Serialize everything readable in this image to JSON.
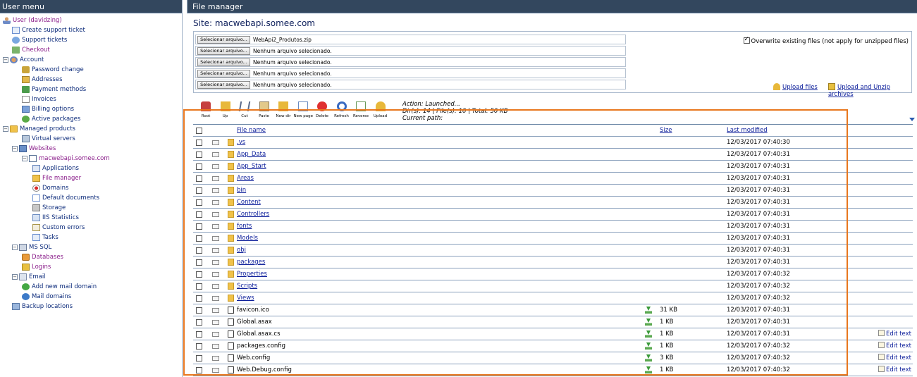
{
  "sidebar": {
    "header": "User menu",
    "items": [
      {
        "label": "User (davidzing)",
        "icon": "user-icon",
        "indent": 0,
        "toggle": "",
        "style": "sel"
      },
      {
        "label": "Create support ticket",
        "icon": "ticket-icon",
        "indent": 1,
        "toggle": "",
        "style": ""
      },
      {
        "label": "Support tickets",
        "icon": "help-icon",
        "indent": 1,
        "toggle": "",
        "style": ""
      },
      {
        "label": "Checkout",
        "icon": "cart-icon",
        "indent": 1,
        "toggle": "",
        "style": "act"
      },
      {
        "label": "Account",
        "icon": "account-icon",
        "indent": 0,
        "toggle": "⊟",
        "style": ""
      },
      {
        "label": "Password change",
        "icon": "key-icon",
        "indent": 2,
        "toggle": "",
        "style": ""
      },
      {
        "label": "Addresses",
        "icon": "address-book-icon",
        "indent": 2,
        "toggle": "",
        "style": ""
      },
      {
        "label": "Payment methods",
        "icon": "credit-card-icon",
        "indent": 2,
        "toggle": "",
        "style": ""
      },
      {
        "label": "Invoices",
        "icon": "invoice-icon",
        "indent": 2,
        "toggle": "",
        "style": ""
      },
      {
        "label": "Billing options",
        "icon": "options-icon",
        "indent": 2,
        "toggle": "",
        "style": ""
      },
      {
        "label": "Active packages",
        "icon": "package-icon",
        "indent": 2,
        "toggle": "",
        "style": ""
      },
      {
        "label": "Managed products",
        "icon": "folder-icon",
        "indent": 0,
        "toggle": "⊟",
        "style": ""
      },
      {
        "label": "Virtual servers",
        "icon": "server-icon",
        "indent": 2,
        "toggle": "",
        "style": ""
      },
      {
        "label": "Websites",
        "icon": "websites-icon",
        "indent": 1,
        "toggle": "⊟",
        "style": "act"
      },
      {
        "label": "macwebapi.somee.com",
        "icon": "site-icon",
        "indent": 2,
        "toggle": "⊟",
        "style": "act"
      },
      {
        "label": "Applications",
        "icon": "applications-icon",
        "indent": 3,
        "toggle": "",
        "style": ""
      },
      {
        "label": "File manager",
        "icon": "file-manager-icon",
        "indent": 3,
        "toggle": "",
        "style": "act"
      },
      {
        "label": "Domains",
        "icon": "domains-icon",
        "indent": 3,
        "toggle": "",
        "style": ""
      },
      {
        "label": "Default documents",
        "icon": "default-docs-icon",
        "indent": 3,
        "toggle": "",
        "style": ""
      },
      {
        "label": "Storage",
        "icon": "storage-icon",
        "indent": 3,
        "toggle": "",
        "style": ""
      },
      {
        "label": "IIS Statistics",
        "icon": "iis-stats-icon",
        "indent": 3,
        "toggle": "",
        "style": ""
      },
      {
        "label": "Custom errors",
        "icon": "custom-errors-icon",
        "indent": 3,
        "toggle": "",
        "style": ""
      },
      {
        "label": "Tasks",
        "icon": "tasks-icon",
        "indent": 3,
        "toggle": "",
        "style": ""
      },
      {
        "label": "MS SQL",
        "icon": "sql-icon",
        "indent": 1,
        "toggle": "⊟",
        "style": ""
      },
      {
        "label": "Databases",
        "icon": "database-icon",
        "indent": 2,
        "toggle": "",
        "style": "act"
      },
      {
        "label": "Logins",
        "icon": "logins-icon",
        "indent": 2,
        "toggle": "",
        "style": "act"
      },
      {
        "label": "Email",
        "icon": "email-icon",
        "indent": 1,
        "toggle": "⊟",
        "style": ""
      },
      {
        "label": "Add new mail domain",
        "icon": "add-mail-icon",
        "indent": 2,
        "toggle": "",
        "style": ""
      },
      {
        "label": "Mail domains",
        "icon": "at-icon",
        "indent": 2,
        "toggle": "",
        "style": ""
      },
      {
        "label": "Backup locations",
        "icon": "backup-icon",
        "indent": 1,
        "toggle": "",
        "style": ""
      }
    ]
  },
  "main": {
    "header": "File manager",
    "site_label": "Site:",
    "site_name": "macwebapi.somee.com",
    "upload": {
      "button_label": "Selecionar arquivo...",
      "rows": [
        "WebApi2_Produtos.zip",
        "Nenhum arquivo selecionado.",
        "Nenhum arquivo selecionado.",
        "Nenhum arquivo selecionado.",
        "Nenhum arquivo selecionado."
      ],
      "overwrite_label": "Overwrite existing files (not apply for unzipped files)",
      "overwrite_checked": true,
      "upload_files_label": "Upload files",
      "upload_unzip_label": "Upload and Unzip archives"
    },
    "toolbar": [
      {
        "label": "Root",
        "icon": "root-icon",
        "cls": "root"
      },
      {
        "label": "Up",
        "icon": "up-folder-icon",
        "cls": "up"
      },
      {
        "label": "Cut",
        "icon": "cut-icon",
        "cls": "cut"
      },
      {
        "label": "Paste",
        "icon": "paste-icon",
        "cls": "paste"
      },
      {
        "label": "New dir",
        "icon": "new-dir-icon",
        "cls": "newdir"
      },
      {
        "label": "New page",
        "icon": "new-page-icon",
        "cls": "newpage"
      },
      {
        "label": "Delete",
        "icon": "delete-icon",
        "cls": "del"
      },
      {
        "label": "Refresh",
        "icon": "refresh-icon",
        "cls": "refresh"
      },
      {
        "label": "Reverse",
        "icon": "reverse-icon",
        "cls": "reverse"
      },
      {
        "label": "Upload",
        "icon": "upload-icon",
        "cls": "upload"
      }
    ],
    "action": {
      "action_line": "Action: Launched...",
      "stats_line": "Dir(s): 14 | File(s): 10 | Total: 50 KB",
      "path_line": "Current path:"
    },
    "table": {
      "col_name": "File name",
      "col_size": "Size",
      "col_modified": "Last modified",
      "edit_label": "Edit text",
      "rows": [
        {
          "name": ".vs",
          "type": "dir",
          "size": "",
          "modified": "12/03/2017 07:40:30",
          "editable": false
        },
        {
          "name": "App_Data",
          "type": "dir",
          "size": "",
          "modified": "12/03/2017 07:40:31",
          "editable": false
        },
        {
          "name": "App_Start",
          "type": "dir",
          "size": "",
          "modified": "12/03/2017 07:40:31",
          "editable": false
        },
        {
          "name": "Areas",
          "type": "dir",
          "size": "",
          "modified": "12/03/2017 07:40:31",
          "editable": false
        },
        {
          "name": "bin",
          "type": "dir",
          "size": "",
          "modified": "12/03/2017 07:40:31",
          "editable": false
        },
        {
          "name": "Content",
          "type": "dir",
          "size": "",
          "modified": "12/03/2017 07:40:31",
          "editable": false
        },
        {
          "name": "Controllers",
          "type": "dir",
          "size": "",
          "modified": "12/03/2017 07:40:31",
          "editable": false
        },
        {
          "name": "fonts",
          "type": "dir",
          "size": "",
          "modified": "12/03/2017 07:40:31",
          "editable": false
        },
        {
          "name": "Models",
          "type": "dir",
          "size": "",
          "modified": "12/03/2017 07:40:31",
          "editable": false
        },
        {
          "name": "obj",
          "type": "dir",
          "size": "",
          "modified": "12/03/2017 07:40:31",
          "editable": false
        },
        {
          "name": "packages",
          "type": "dir",
          "size": "",
          "modified": "12/03/2017 07:40:31",
          "editable": false
        },
        {
          "name": "Properties",
          "type": "dir",
          "size": "",
          "modified": "12/03/2017 07:40:32",
          "editable": false
        },
        {
          "name": "Scripts",
          "type": "dir",
          "size": "",
          "modified": "12/03/2017 07:40:32",
          "editable": false
        },
        {
          "name": "Views",
          "type": "dir",
          "size": "",
          "modified": "12/03/2017 07:40:32",
          "editable": false
        },
        {
          "name": "favicon.ico",
          "type": "file",
          "size": "31 KB",
          "modified": "12/03/2017 07:40:31",
          "editable": false
        },
        {
          "name": "Global.asax",
          "type": "file",
          "size": "1 KB",
          "modified": "12/03/2017 07:40:31",
          "editable": false
        },
        {
          "name": "Global.asax.cs",
          "type": "file",
          "size": "1 KB",
          "modified": "12/03/2017 07:40:31",
          "editable": true
        },
        {
          "name": "packages.config",
          "type": "file",
          "size": "1 KB",
          "modified": "12/03/2017 07:40:32",
          "editable": true
        },
        {
          "name": "Web.config",
          "type": "file",
          "size": "3 KB",
          "modified": "12/03/2017 07:40:32",
          "editable": true
        },
        {
          "name": "Web.Debug.config",
          "type": "file",
          "size": "1 KB",
          "modified": "12/03/2017 07:40:32",
          "editable": true
        }
      ]
    },
    "colors": {
      "header_bg": "#33475e",
      "link": "#0b1d9a",
      "highlight": "#e8771e"
    }
  }
}
